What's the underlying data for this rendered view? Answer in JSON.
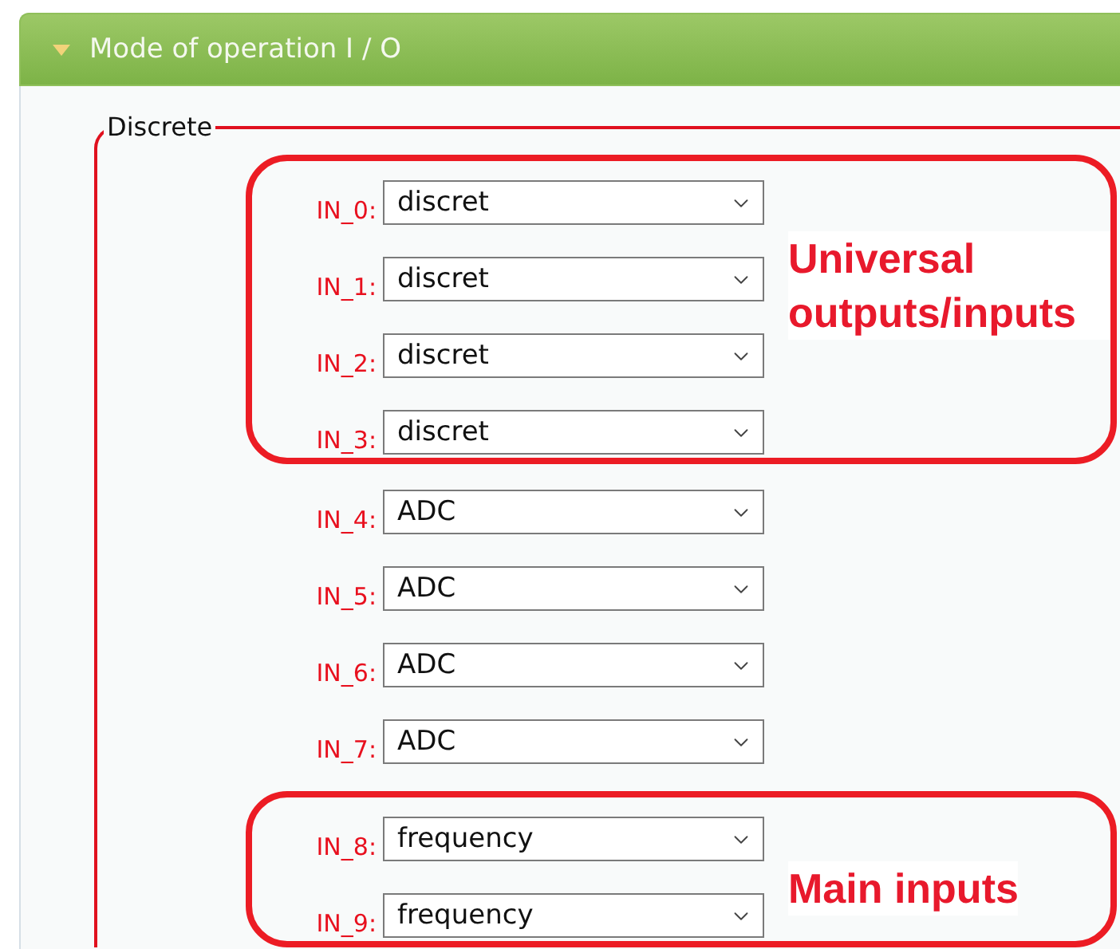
{
  "panel": {
    "title": "Mode of operation I / O",
    "expanded": true
  },
  "fieldset": {
    "legend": "Discrete"
  },
  "groups": [
    {
      "annotation": "Universal outputs/inputs",
      "rows": [
        {
          "label": "IN_0:",
          "value": "discret"
        },
        {
          "label": "IN_1:",
          "value": "discret"
        },
        {
          "label": "IN_2:",
          "value": "discret"
        },
        {
          "label": "IN_3:",
          "value": "discret"
        }
      ]
    },
    {
      "rows": [
        {
          "label": "IN_4:",
          "value": "ADC"
        },
        {
          "label": "IN_5:",
          "value": "ADC"
        },
        {
          "label": "IN_6:",
          "value": "ADC"
        },
        {
          "label": "IN_7:",
          "value": "ADC"
        }
      ]
    },
    {
      "annotation": "Main inputs",
      "rows": [
        {
          "label": "IN_8:",
          "value": "frequency"
        },
        {
          "label": "IN_9:",
          "value": "frequency"
        }
      ]
    }
  ]
}
